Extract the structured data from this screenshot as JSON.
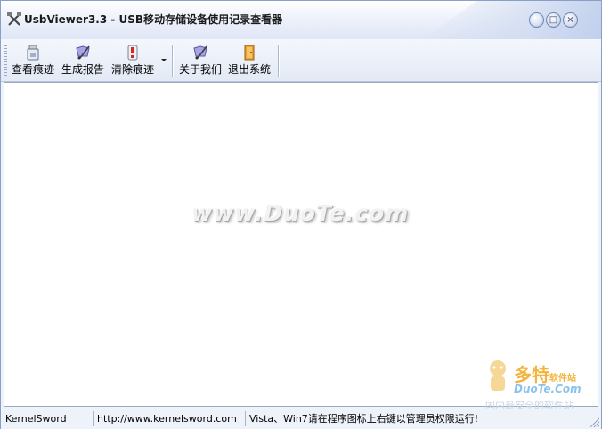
{
  "window": {
    "title": "UsbViewer3.3 - USB移动存储设备使用记录查看器",
    "minimize_glyph": "–",
    "maximize_glyph": "□",
    "close_glyph": "×"
  },
  "toolbar": {
    "buttons": [
      {
        "label": "查看痕迹",
        "icon": "usb-drive-icon"
      },
      {
        "label": "生成报告",
        "icon": "report-pen-icon"
      },
      {
        "label": "清除痕迹",
        "icon": "warning-drive-icon"
      },
      {
        "label": "关于我们",
        "icon": "about-pen-icon"
      },
      {
        "label": "退出系统",
        "icon": "exit-door-icon"
      }
    ]
  },
  "content": {
    "watermark": "www.DuoTe.com",
    "corner_logo": {
      "brand": "多特",
      "brand_suffix": "软件站",
      "url": "DuoTe.Com",
      "slogan": "国内最安全的软件站"
    }
  },
  "statusbar": {
    "panel1": "KernelSword",
    "panel2": "http://www.kernelsword.com",
    "panel3": "Vista、Win7请在程序图标上右键以管理员权限运行!"
  },
  "colors": {
    "accent": "#8a9fc7",
    "watermark_brand": "#f2a71c",
    "watermark_url": "#6db3e8"
  }
}
